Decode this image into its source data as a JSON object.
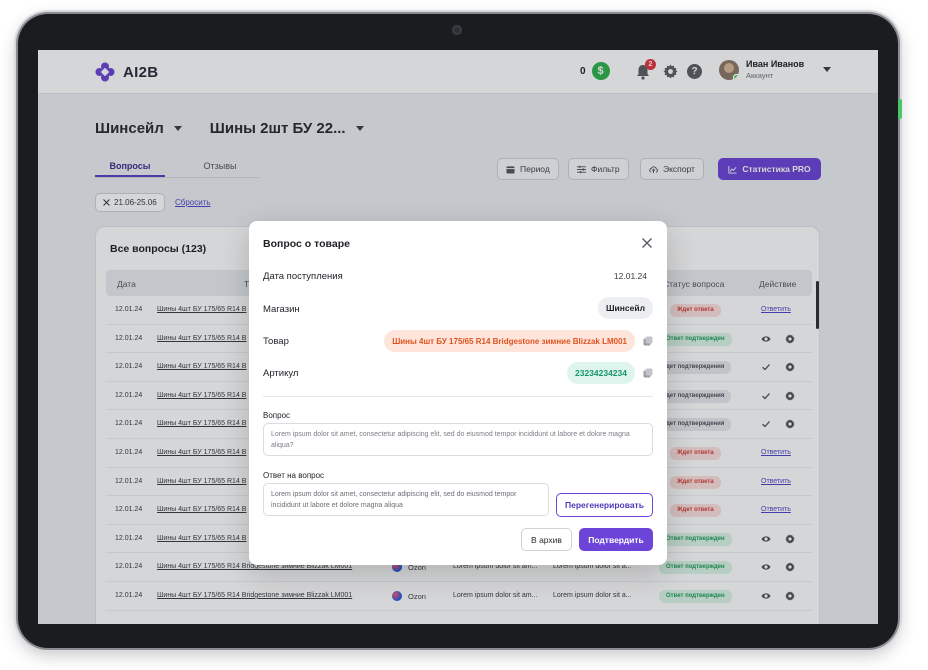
{
  "app": {
    "logo_text": "AI2B",
    "logo_icon": "flower-logo-icon"
  },
  "header": {
    "balance_value": "0",
    "balance_icon": "dollar-icon",
    "notifications_count": "2",
    "user_name": "Иван Иванов",
    "user_role": "Аккаунт"
  },
  "breadcrumbs": {
    "store": "Шинсейл",
    "product": "Шины 2шт БУ 22..."
  },
  "tabs": [
    {
      "label": "Вопросы",
      "active": true
    },
    {
      "label": "Отзывы",
      "active": false
    }
  ],
  "toolbar": {
    "period_label": "Период",
    "filter_label": "Фильтр",
    "export_label": "Экспорт",
    "stats_label": "Статистика PRO"
  },
  "filters": {
    "chip_label": "21.06-25.06",
    "reset_label": "Сбросить"
  },
  "table": {
    "title": "Все вопросы (123)",
    "columns": {
      "date": "Дата",
      "product": "Т",
      "status": "Статус вопроса",
      "action": "Действие"
    },
    "rows": [
      {
        "date": "12.01.24",
        "product": "Шины 4шт БУ 175/65 R14 B",
        "status": "Ждет ответа",
        "status_type": "wait",
        "action": "Ответить"
      },
      {
        "date": "12.01.24",
        "product": "Шины 4шт БУ 175/65 R14 B",
        "status": "Ответ подтвержден",
        "status_type": "conf",
        "action": "icons"
      },
      {
        "date": "12.01.24",
        "product": "Шины 4шт БУ 175/65 R14 B",
        "status": "дет подтверждения",
        "status_type": "nconf",
        "action": "check"
      },
      {
        "date": "12.01.24",
        "product": "Шины 4шт БУ 175/65 R14 B",
        "status": "дет подтверждения",
        "status_type": "nconf",
        "action": "check"
      },
      {
        "date": "12.01.24",
        "product": "Шины 4шт БУ 175/65 R14 B",
        "status": "дет подтверждения",
        "status_type": "nconf",
        "action": "check"
      },
      {
        "date": "12.01.24",
        "product": "Шины 4шт БУ 175/65 R14 B",
        "status": "Ждет ответа",
        "status_type": "wait",
        "action": "Ответить"
      },
      {
        "date": "12.01.24",
        "product": "Шины 4шт БУ 175/65 R14 B",
        "status": "Ждет ответа",
        "status_type": "wait",
        "action": "Ответить"
      },
      {
        "date": "12.01.24",
        "product": "Шины 4шт БУ 175/65 R14 B",
        "status": "Ждет ответа",
        "status_type": "wait",
        "action": "Ответить"
      },
      {
        "date": "12.01.24",
        "product": "Шины 4шт БУ 175/65 R14 B",
        "status": "Ответ подтвержден",
        "status_type": "conf",
        "action": "icons"
      },
      {
        "date": "12.01.24",
        "product": "Шины 4шт БУ 175/65 R14 Bridgestone зимние Blizzak LM001",
        "marketplace": "Ozon",
        "question": "Lorem ipsum dolor sit am...",
        "answer": "Lorem ipsum dolor sit a...",
        "status": "Ответ подтвержден",
        "status_type": "conf",
        "action": "icons"
      },
      {
        "date": "12.01.24",
        "product": "Шины 4шт БУ 175/65 R14 Bridgestone зимние Blizzak LM001",
        "marketplace": "Ozon",
        "question": "Lorem ipsum dolor sit am...",
        "answer": "Lorem ipsum dolor sit a...",
        "status": "Ответ подтвержден",
        "status_type": "conf",
        "action": "icons"
      }
    ]
  },
  "modal": {
    "title": "Вопрос о товаре",
    "date_label": "Дата поступления",
    "date_value": "12.01.24",
    "shop_label": "Магазин",
    "shop_value": "Шинсейл",
    "product_label": "Товар",
    "product_value": "Шины 4шт БУ 175/65 R14 Bridgestone зимние Blizzak LM001",
    "article_label": "Артикул",
    "article_value": "23234234234",
    "question_label": "Вопрос",
    "question_text": "Lorem ipsum dolor sit amet, consectetur adipiscing elit, sed do eiusmod tempor incididunt ut labore et dolore magna aliqua?",
    "answer_label": "Ответ на вопрос",
    "answer_text": "Lorem ipsum dolor sit amet, consectetur adipiscing elit, sed do eiusmod tempor incididunt ut labore et dolore magna aliqua",
    "regenerate_label": "Перегенерировать",
    "archive_label": "В архив",
    "confirm_label": "Подтвердить"
  },
  "colors": {
    "accent": "#6c45d8",
    "success": "#2fb24c",
    "danger": "#e5343c",
    "product_pill": "#e0531f",
    "article_pill": "#17966a"
  }
}
